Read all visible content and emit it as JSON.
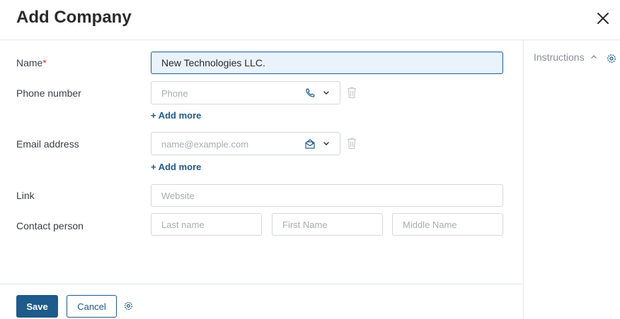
{
  "dialog": {
    "title": "Add Company"
  },
  "sidebar": {
    "instructions_label": "Instructions"
  },
  "form": {
    "name": {
      "label": "Name",
      "required_mark": "*",
      "value": "New Technologies LLC."
    },
    "phone": {
      "label": "Phone number",
      "placeholder": "Phone",
      "add_more": "+ Add more"
    },
    "email": {
      "label": "Email address",
      "placeholder": "name@example.com",
      "add_more": "+ Add more"
    },
    "link": {
      "label": "Link",
      "placeholder": "Website"
    },
    "contact": {
      "label": "Contact person",
      "last_name_placeholder": "Last name",
      "first_name_placeholder": "First Name",
      "middle_name_placeholder": "Middle Name"
    }
  },
  "footer": {
    "save_label": "Save",
    "cancel_label": "Cancel"
  },
  "colors": {
    "accent": "#1e5a8a",
    "required": "#d32f2f",
    "focus_bg": "#eaf2fb"
  }
}
